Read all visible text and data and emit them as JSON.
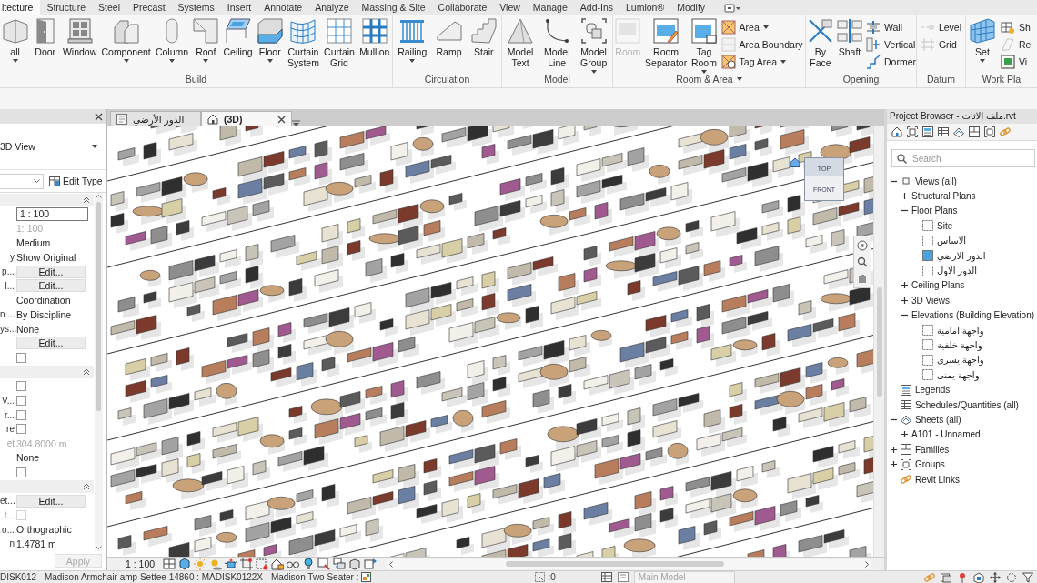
{
  "ribbon": {
    "tabs": [
      {
        "label": "itecture",
        "selected": true
      },
      {
        "label": "Structure",
        "selected": false
      },
      {
        "label": "Steel",
        "selected": false
      },
      {
        "label": "Precast",
        "selected": false
      },
      {
        "label": "Systems",
        "selected": false
      },
      {
        "label": "Insert",
        "selected": false
      },
      {
        "label": "Annotate",
        "selected": false
      },
      {
        "label": "Analyze",
        "selected": false
      },
      {
        "label": "Massing & Site",
        "selected": false
      },
      {
        "label": "Collaborate",
        "selected": false
      },
      {
        "label": "View",
        "selected": false
      },
      {
        "label": "Manage",
        "selected": false
      },
      {
        "label": "Add-Ins",
        "selected": false
      },
      {
        "label": "Lumion®",
        "selected": false
      },
      {
        "label": "Modify",
        "selected": false
      }
    ],
    "panels": [
      {
        "label": "Build",
        "dropdown": false,
        "tools": [
          {
            "kind": "large",
            "label": "all",
            "dropdown": true,
            "disabled": false
          },
          {
            "kind": "large",
            "label": "Door",
            "dropdown": false,
            "disabled": false
          },
          {
            "kind": "large",
            "label": "Window",
            "dropdown": false,
            "disabled": false
          },
          {
            "kind": "large",
            "label": "Component",
            "dropdown": true,
            "disabled": false
          },
          {
            "kind": "large",
            "label": "Column",
            "dropdown": true,
            "disabled": false
          },
          {
            "kind": "large",
            "label": "Roof",
            "dropdown": true,
            "disabled": false
          },
          {
            "kind": "large",
            "label": "Ceiling",
            "dropdown": false,
            "disabled": false
          },
          {
            "kind": "large",
            "label": "Floor",
            "dropdown": true,
            "disabled": false
          },
          {
            "kind": "large",
            "label": "Curtain System",
            "dropdown": false,
            "disabled": false
          },
          {
            "kind": "large",
            "label": "Curtain Grid",
            "dropdown": false,
            "disabled": false
          },
          {
            "kind": "large",
            "label": "Mullion",
            "dropdown": false,
            "disabled": false
          }
        ]
      },
      {
        "label": "Circulation",
        "dropdown": false,
        "tools": [
          {
            "kind": "large",
            "label": "Railing",
            "dropdown": true,
            "disabled": false
          },
          {
            "kind": "large",
            "label": "Ramp",
            "dropdown": false,
            "disabled": false
          },
          {
            "kind": "large",
            "label": "Stair",
            "dropdown": false,
            "disabled": false
          }
        ]
      },
      {
        "label": "Model",
        "dropdown": false,
        "tools": [
          {
            "kind": "large",
            "label": "Model Text",
            "dropdown": false,
            "disabled": false
          },
          {
            "kind": "large",
            "label": "Model Line",
            "dropdown": false,
            "disabled": false
          },
          {
            "kind": "large",
            "label": "Model Group",
            "dropdown": true,
            "disabled": false
          }
        ]
      },
      {
        "label": "Room & Area",
        "dropdown": true,
        "tools": [
          {
            "kind": "large",
            "label": "Room",
            "dropdown": false,
            "disabled": true
          },
          {
            "kind": "large",
            "label": "Room Separator",
            "dropdown": false,
            "disabled": false
          },
          {
            "kind": "large",
            "label": "Tag Room",
            "dropdown": true,
            "disabled": false
          },
          {
            "kind": "small",
            "label": "Area",
            "dropdown": true,
            "disabled": false
          },
          {
            "kind": "small",
            "label": "Area Boundary",
            "dropdown": false,
            "disabled": true
          },
          {
            "kind": "small",
            "label": "Tag Area",
            "dropdown": true,
            "disabled": false
          }
        ]
      },
      {
        "label": "Opening",
        "dropdown": false,
        "tools": [
          {
            "kind": "large",
            "label": "By Face",
            "dropdown": false,
            "disabled": false
          },
          {
            "kind": "large",
            "label": "Shaft",
            "dropdown": false,
            "disabled": false
          },
          {
            "kind": "small",
            "label": "Wall",
            "dropdown": false,
            "disabled": false
          },
          {
            "kind": "small",
            "label": "Vertical",
            "dropdown": false,
            "disabled": false
          },
          {
            "kind": "small",
            "label": "Dormer",
            "dropdown": false,
            "disabled": false
          }
        ]
      },
      {
        "label": "Datum",
        "dropdown": false,
        "tools": [
          {
            "kind": "small",
            "label": "Level",
            "dropdown": false,
            "disabled": true
          },
          {
            "kind": "small",
            "label": "Grid",
            "dropdown": false,
            "disabled": true
          }
        ]
      },
      {
        "label": "Work Pla",
        "dropdown": false,
        "tools": [
          {
            "kind": "large",
            "label": "Set",
            "dropdown": true,
            "disabled": false
          },
          {
            "kind": "small",
            "label": "Sh",
            "dropdown": false,
            "disabled": false
          },
          {
            "kind": "small",
            "label": "Re",
            "dropdown": false,
            "disabled": true
          },
          {
            "kind": "small",
            "label": "Vi",
            "dropdown": false,
            "disabled": false
          }
        ]
      }
    ]
  },
  "properties": {
    "type": "3D View",
    "edit_type": "Edit Type",
    "rows": [
      {
        "kind": "header",
        "expanded": true
      },
      {
        "kind": "field",
        "value": "1 : 100"
      },
      {
        "kind": "text",
        "value": "1: 100",
        "disabled": true
      },
      {
        "kind": "text",
        "value": "Medium",
        "disabled": false
      },
      {
        "kind": "text",
        "label": "y",
        "value": "Show Original",
        "disabled": false
      },
      {
        "kind": "button",
        "label": "p...",
        "value": "Edit..."
      },
      {
        "kind": "button",
        "label": "l...",
        "value": "Edit..."
      },
      {
        "kind": "text",
        "value": "Coordination",
        "disabled": false
      },
      {
        "kind": "text",
        "label": "n ...",
        "value": "By Discipline",
        "disabled": false
      },
      {
        "kind": "text",
        "label": "ys...",
        "value": "None",
        "disabled": false
      },
      {
        "kind": "button",
        "value": "Edit..."
      },
      {
        "kind": "checkbox",
        "checked": false,
        "disabled": false
      },
      {
        "kind": "header",
        "expanded": true
      },
      {
        "kind": "checkbox",
        "checked": false,
        "disabled": false
      },
      {
        "kind": "checkbox",
        "label": "V...",
        "checked": false,
        "disabled": false
      },
      {
        "kind": "checkbox",
        "label": "r...",
        "checked": false,
        "disabled": false
      },
      {
        "kind": "checkbox",
        "label": "re",
        "checked": false,
        "disabled": false
      },
      {
        "kind": "text",
        "label": "et",
        "value": "304.8000 m",
        "disabled": true
      },
      {
        "kind": "text",
        "value": "None",
        "disabled": false
      },
      {
        "kind": "checkbox",
        "checked": false,
        "disabled": false
      },
      {
        "kind": "header",
        "expanded": true
      },
      {
        "kind": "button",
        "label": "et...",
        "value": "Edit..."
      },
      {
        "kind": "checkbox",
        "label": "t...",
        "checked": false,
        "disabled": true
      },
      {
        "kind": "text",
        "label": "o...",
        "value": "Orthographic",
        "disabled": false
      },
      {
        "kind": "text",
        "label": "n",
        "value": "1.4781 m",
        "disabled": false
      }
    ],
    "apply": {
      "label": "Apply",
      "disabled": true
    }
  },
  "viewport": {
    "tabs": [
      {
        "label": "الدور الأرضي",
        "kind": "plan",
        "selected": false
      },
      {
        "label": "(3D)",
        "kind": "model",
        "selected": true
      }
    ],
    "view_cube": {
      "top": "TOP",
      "front": "FRONT"
    },
    "scale": "1 : 100"
  },
  "project_browser": {
    "title": "Project Browser - ملف الاثاث.rvt",
    "search": {
      "placeholder": "Search"
    },
    "tree": [
      {
        "label": "Views (all)",
        "kind": "views",
        "expanded": true,
        "children": [
          {
            "label": "Structural Plans",
            "kind": "category",
            "expanded": false
          },
          {
            "label": "Floor Plans",
            "kind": "category",
            "expanded": true,
            "children": [
              {
                "label": "Site",
                "kind": "view",
                "open": false
              },
              {
                "label": "الاساس",
                "kind": "view",
                "open": false
              },
              {
                "label": "الدور الارضي",
                "kind": "view",
                "open": true
              },
              {
                "label": "الدور الاول",
                "kind": "view",
                "open": false
              }
            ]
          },
          {
            "label": "Ceiling Plans",
            "kind": "category",
            "expanded": false
          },
          {
            "label": "3D Views",
            "kind": "category",
            "expanded": false
          },
          {
            "label": "Elevations (Building Elevation)",
            "kind": "category",
            "expanded": true,
            "children": [
              {
                "label": "واجهة امامية",
                "kind": "view",
                "open": false
              },
              {
                "label": "واجهة خلفية",
                "kind": "view",
                "open": false
              },
              {
                "label": "واجهة يسرى",
                "kind": "view",
                "open": false
              },
              {
                "label": "واجهة يمنى",
                "kind": "view",
                "open": false
              }
            ]
          }
        ]
      },
      {
        "label": "Legends",
        "kind": "legends"
      },
      {
        "label": "Schedules/Quantities (all)",
        "kind": "schedules"
      },
      {
        "label": "Sheets (all)",
        "kind": "sheets",
        "expanded": true,
        "children": [
          {
            "label": "A101 - Unnamed",
            "kind": "category",
            "expanded": false
          }
        ]
      },
      {
        "label": "Families",
        "kind": "families",
        "expanded": false
      },
      {
        "label": "Groups",
        "kind": "groups",
        "expanded": false
      },
      {
        "label": "Revit Links",
        "kind": "links"
      }
    ]
  },
  "status_bar": {
    "selection": "DISK012 - Madison Armchair amp Settee 14860 : MADISK0122X - Madison Two Seater :",
    "count": ":0",
    "workset": {
      "value": "Main Model",
      "disabled": true
    }
  }
}
